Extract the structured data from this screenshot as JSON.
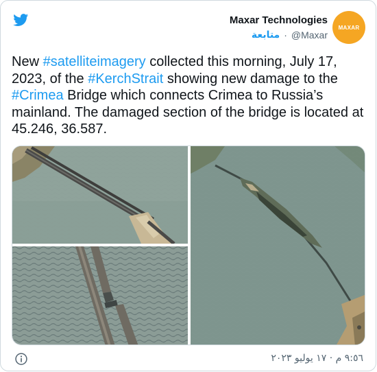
{
  "tweet": {
    "author_name": "Maxar Technologies",
    "author_handle": "@Maxar",
    "follow_label": "متابعة",
    "separator": "·",
    "avatar_text": "MAXAR",
    "text_parts": [
      {
        "text": "New ",
        "tag": false
      },
      {
        "text": "#satelliteimagery",
        "tag": true
      },
      {
        "text": " collected this morning, July 17, 2023, of the ",
        "tag": false
      },
      {
        "text": "#KerchStrait",
        "tag": true
      },
      {
        "text": " showing new damage to the ",
        "tag": false
      },
      {
        "text": "#Crimea",
        "tag": true
      },
      {
        "text": " Bridge which connects Crimea to Russia’s mainland. The damaged section of the bridge is located at 45.246, 36.587.",
        "tag": false
      }
    ],
    "timestamp": "٩:٥٦ م · ١٧ يوليو ٢٠٢٣"
  },
  "icons": {
    "brand": "twitter-bird-icon",
    "info": "info-icon"
  },
  "colors": {
    "accent": "#1d9bf0",
    "text": "#0f1419",
    "muted": "#536471",
    "avatar_bg": "#f5a623",
    "border": "#cfd9de"
  }
}
